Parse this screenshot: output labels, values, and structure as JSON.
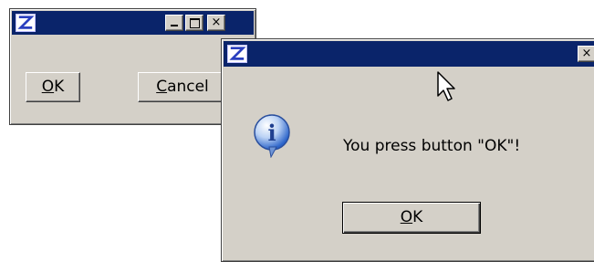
{
  "colors": {
    "titlebar_active": "#0a246a",
    "face": "#d4d0c8",
    "icon_blue": "#2a63c9"
  },
  "back_window": {
    "app_icon": "app-logo-icon",
    "caption_buttons": [
      "minimize-icon",
      "maximize-icon",
      "close-icon"
    ],
    "buttons": {
      "ok": {
        "mnemonic": "O",
        "rest": "K"
      },
      "cancel": {
        "mnemonic": "C",
        "rest": "ancel"
      }
    }
  },
  "dialog": {
    "app_icon": "app-logo-icon",
    "close_glyph": "×",
    "info_icon": "information-icon",
    "info_glyph": "i",
    "message": "You press button \"OK\"!",
    "ok_button": {
      "mnemonic": "O",
      "rest": "K"
    }
  },
  "cursor": "arrow-cursor-icon"
}
